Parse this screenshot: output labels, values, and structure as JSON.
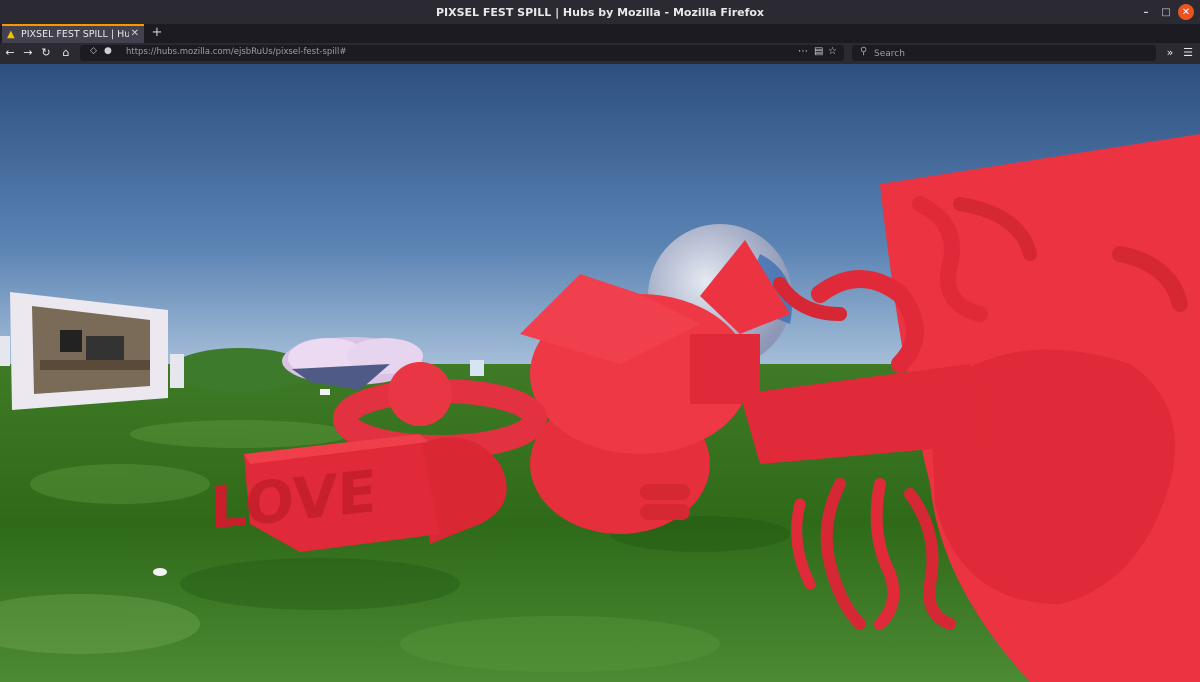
{
  "window": {
    "title": "PIXSEL FEST SPILL | Hubs by Mozilla - Mozilla Firefox"
  },
  "tabs": [
    {
      "label": "PIXSEL FEST SPILL | Hub",
      "active": true
    }
  ],
  "navbar": {
    "url": "https://hubs.mozilla.com/ejsbRuUs/pixsel-fest-spill#",
    "search_placeholder": "Search",
    "search_value": ""
  },
  "scene": {
    "sculpture_text": "LOVE",
    "accent_color": "#e8323f",
    "sky_top": "#2f5385",
    "sky_bottom": "#a9c3dd",
    "grass_color": "#2f6a16"
  },
  "icons": {
    "back": "back-arrow-icon",
    "forward": "forward-arrow-icon",
    "reload": "reload-icon",
    "home": "home-icon",
    "lock": "lock-icon",
    "search": "search-icon",
    "overflow": "chevron-double-right-icon",
    "menu": "hamburger-menu-icon"
  }
}
